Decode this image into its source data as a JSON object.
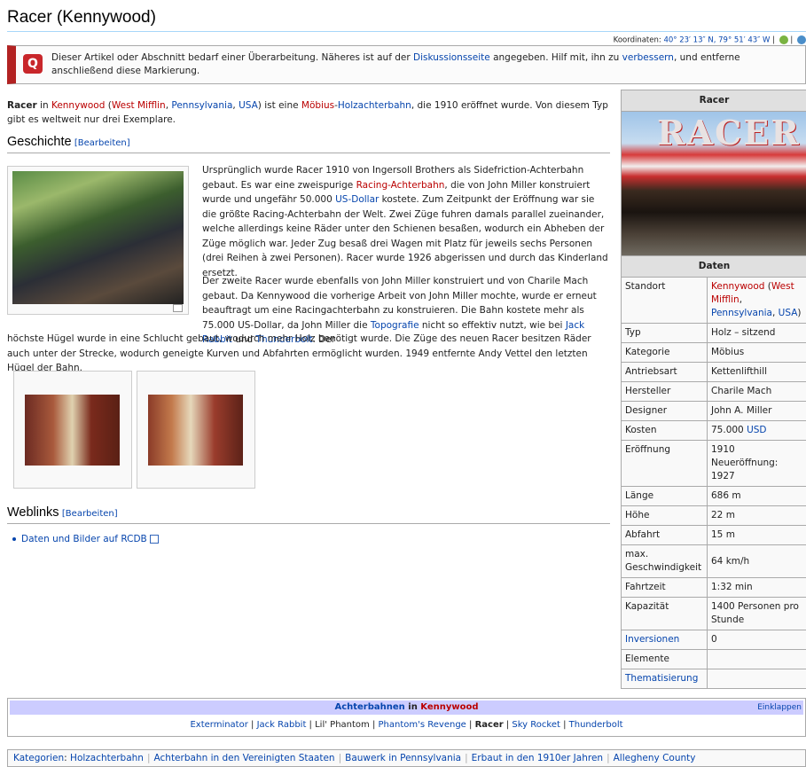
{
  "page": {
    "title": "Racer (Kennywood)",
    "coords_label": "Koordinaten:",
    "coords_value": "40° 23′ 13″ N, 79° 51′ 43″ W",
    "coords_sep": "|"
  },
  "ambox": {
    "icon": "Q",
    "text_1": "Dieser Artikel oder Abschnitt bedarf einer Überarbeitung. Näheres ist auf der ",
    "link_1": "Diskussionsseite",
    "text_2": " angegeben. Hilf mit, ihn zu ",
    "link_2": "verbessern",
    "text_3": ", und entferne anschließend diese Markierung."
  },
  "intro": {
    "bold": "Racer",
    "in": " in ",
    "kennywood": "Kennywood",
    "open": " (",
    "west_mifflin": "West Mifflin",
    "comma1": ", ",
    "pennsylvania": "Pennsylvania",
    "comma2": ", ",
    "usa": "USA",
    "mid": ") ist eine ",
    "moebius": "Möbius",
    "dash": "-",
    "holz": "Holzachterbahn",
    "rest": ", die 1910 eröffnet wurde. Von diesem Typ gibt es weltweit nur drei Exemplare."
  },
  "sections": {
    "geschichte": "Geschichte",
    "weblinks": "Weblinks",
    "edit": "[Bearbeiten]"
  },
  "geschichte": {
    "p1_a": "Ursprünglich wurde Racer 1910 von Ingersoll Brothers als Sidefriction-Achterbahn gebaut. Es war eine zweispurige ",
    "p1_link1": "Racing-Achterbahn",
    "p1_b": ", die von John Miller konstruiert wurde und ungefähr 50.000 ",
    "p1_link2": "US-Dollar",
    "p1_c": " kostete. Zum Zeitpunkt der Eröffnung war sie die größte Racing-Achterbahn der Welt. Zwei Züge fuhren damals parallel zueinander, welche allerdings keine Räder unter den Schienen besaßen, wodurch ein Abheben der Züge möglich war. Jeder Zug besaß drei Wagen mit Platz für jeweils sechs Personen (drei Reihen à zwei Personen). Racer wurde 1926 abgerissen und durch das Kinderland ersetzt.",
    "p2_a": "Der zweite Racer wurde ebenfalls von John Miller konstruiert und von Charile Mach gebaut. Da Kennywood die vorherige Arbeit von John Miller mochte, wurde er erneut beauftragt um eine Racingachterbahn zu konstruieren. Die Bahn kostete mehr als 75.000 US-Dollar, da John Miller die ",
    "p2_link1": "Topografie",
    "p2_b": " nicht so effektiv nutzt, wie bei ",
    "p2_link2": "Jack Rabbit",
    "p2_c": " und ",
    "p2_link3": "Thunderbolt",
    "p2_d": ". Der",
    "p2_cont": "höchste Hügel wurde in eine Schlucht gebaut, wodurch mehr Holz benötigt wurde. Die Züge des neuen Racer besitzen Räder auch unter der Strecke, wodurch geneigte Kurven und Abfahrten ermöglicht wurden. 1949 entfernte Andy Vettel den letzten Hügel der Bahn."
  },
  "weblinks": {
    "item": "Daten und Bilder auf RCDB"
  },
  "infobox": {
    "title": "Racer",
    "image_sign": "RACER",
    "daten": "Daten",
    "standort_label": "Standort",
    "standort_link1": "Kennywood",
    "standort_open": " (",
    "standort_link2": "West Mifflin",
    "standort_comma": ", ",
    "standort_link3": "Pennsylvania",
    "standort_comma2": ", ",
    "standort_link4": "USA",
    "standort_close": ")",
    "rows": [
      {
        "label": "Typ",
        "value": "Holz – sitzend"
      },
      {
        "label": "Kategorie",
        "value": "Möbius"
      },
      {
        "label": "Antriebsart",
        "value": "Kettenlifthill"
      },
      {
        "label": "Hersteller",
        "value": "Charile Mach"
      },
      {
        "label": "Designer",
        "value": "John A. Miller"
      }
    ],
    "kosten_label": "Kosten",
    "kosten_value": "75.000 ",
    "kosten_link": "USD",
    "eroeffnung_label": "Eröffnung",
    "eroeffnung_value": "1910",
    "eroeffnung_value2": "Neueröffnung: 1927",
    "rows2": [
      {
        "label": "Länge",
        "value": "686 m"
      },
      {
        "label": "Höhe",
        "value": "22 m"
      },
      {
        "label": "Abfahrt",
        "value": "15 m"
      },
      {
        "label": "max. Geschwindigkeit",
        "value": "64 km/h"
      },
      {
        "label": "Fahrtzeit",
        "value": "1:32 min"
      },
      {
        "label": "Kapazität",
        "value": "1400 Personen pro Stunde"
      }
    ],
    "inversionen_label": "Inversionen",
    "inversionen_value": "0",
    "elemente_label": "Elemente",
    "elemente_value": "",
    "thematisierung_label": "Thematisierung",
    "thematisierung_value": ""
  },
  "navbox": {
    "title_a": "Achterbahnen",
    "title_in": " in ",
    "title_b": "Kennywood",
    "einklappen": "Einklappen",
    "items": [
      "Exterminator",
      "Jack Rabbit",
      "Lil' Phantom",
      "Phantom's Revenge",
      "Racer",
      "Sky Rocket",
      "Thunderbolt"
    ]
  },
  "categories": {
    "label": "Kategorien",
    "items": [
      "Holzachterbahn",
      "Achterbahn in den Vereinigten Staaten",
      "Bauwerk in Pennsylvania",
      "Erbaut in den 1910er Jahren",
      "Allegheny County"
    ]
  }
}
